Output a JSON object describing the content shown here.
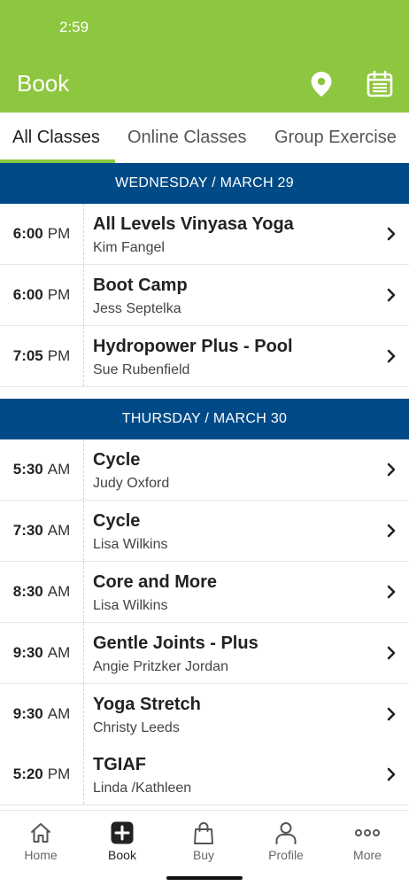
{
  "status_bar": {
    "time": "2:59"
  },
  "header": {
    "title": "Book",
    "location_icon": "location-pin-icon",
    "calendar_icon": "calendar-icon",
    "color": "#8dc63f"
  },
  "tabs": [
    {
      "label": "All Classes",
      "active": true
    },
    {
      "label": "Online Classes",
      "active": false
    },
    {
      "label": "Group Exercise",
      "active": false
    }
  ],
  "days": [
    {
      "label": "WEDNESDAY / MARCH 29",
      "classes": [
        {
          "time": "6:00",
          "ampm": "PM",
          "name": "All Levels Vinyasa Yoga",
          "instructor": "Kim Fangel"
        },
        {
          "time": "6:00",
          "ampm": "PM",
          "name": "Boot Camp",
          "instructor": "Jess Septelka"
        },
        {
          "time": "7:05",
          "ampm": "PM",
          "name": "Hydropower Plus - Pool",
          "instructor": "Sue Rubenfield"
        }
      ]
    },
    {
      "label": "THURSDAY / MARCH 30",
      "classes": [
        {
          "time": "5:30",
          "ampm": "AM",
          "name": "Cycle",
          "instructor": "Judy Oxford"
        },
        {
          "time": "7:30",
          "ampm": "AM",
          "name": "Cycle",
          "instructor": "Lisa Wilkins"
        },
        {
          "time": "8:30",
          "ampm": "AM",
          "name": "Core and More",
          "instructor": "Lisa Wilkins"
        },
        {
          "time": "9:30",
          "ampm": "AM",
          "name": "Gentle Joints - Plus",
          "instructor": "Angie Pritzker Jordan"
        },
        {
          "time": "9:30",
          "ampm": "AM",
          "name": "Yoga Stretch",
          "instructor": "Christy Leeds"
        },
        {
          "time": "5:20",
          "ampm": "PM",
          "name": "TGIAF",
          "instructor": "Linda /Kathleen"
        }
      ]
    }
  ],
  "bottom_nav": [
    {
      "label": "Home",
      "icon": "home-icon",
      "active": false
    },
    {
      "label": "Book",
      "icon": "plus-square-icon",
      "active": true
    },
    {
      "label": "Buy",
      "icon": "shopping-bag-icon",
      "active": false
    },
    {
      "label": "Profile",
      "icon": "person-icon",
      "active": false
    },
    {
      "label": "More",
      "icon": "more-dots-icon",
      "active": false
    }
  ],
  "colors": {
    "accent": "#8dc63f",
    "day_header": "#004b87"
  }
}
